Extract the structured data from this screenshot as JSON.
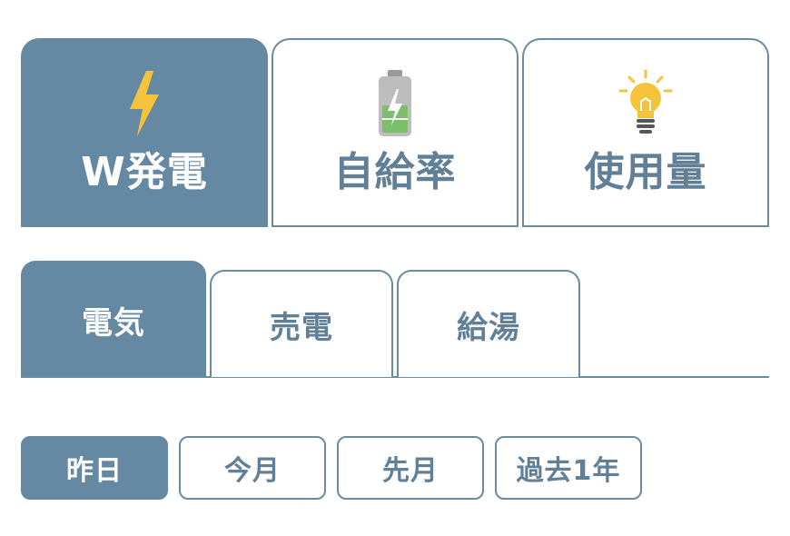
{
  "main_tabs": [
    {
      "label": "W発電",
      "icon": "lightning-bolt-icon",
      "active": true
    },
    {
      "label": "自給率",
      "icon": "battery-icon",
      "active": false
    },
    {
      "label": "使用量",
      "icon": "light-bulb-icon",
      "active": false
    }
  ],
  "sub_tabs": [
    {
      "label": "電気",
      "active": true
    },
    {
      "label": "売電",
      "active": false
    },
    {
      "label": "給湯",
      "active": false
    }
  ],
  "period_buttons": [
    {
      "label": "昨日",
      "active": true
    },
    {
      "label": "今月",
      "active": false
    },
    {
      "label": "先月",
      "active": false
    },
    {
      "label": "過去1年",
      "active": false
    }
  ],
  "colors": {
    "accent": "#6589a2",
    "text": "#617f96",
    "bolt": "#f5c33b",
    "battery_fill": "#7cbf6a",
    "bulb": "#f5c33b"
  }
}
